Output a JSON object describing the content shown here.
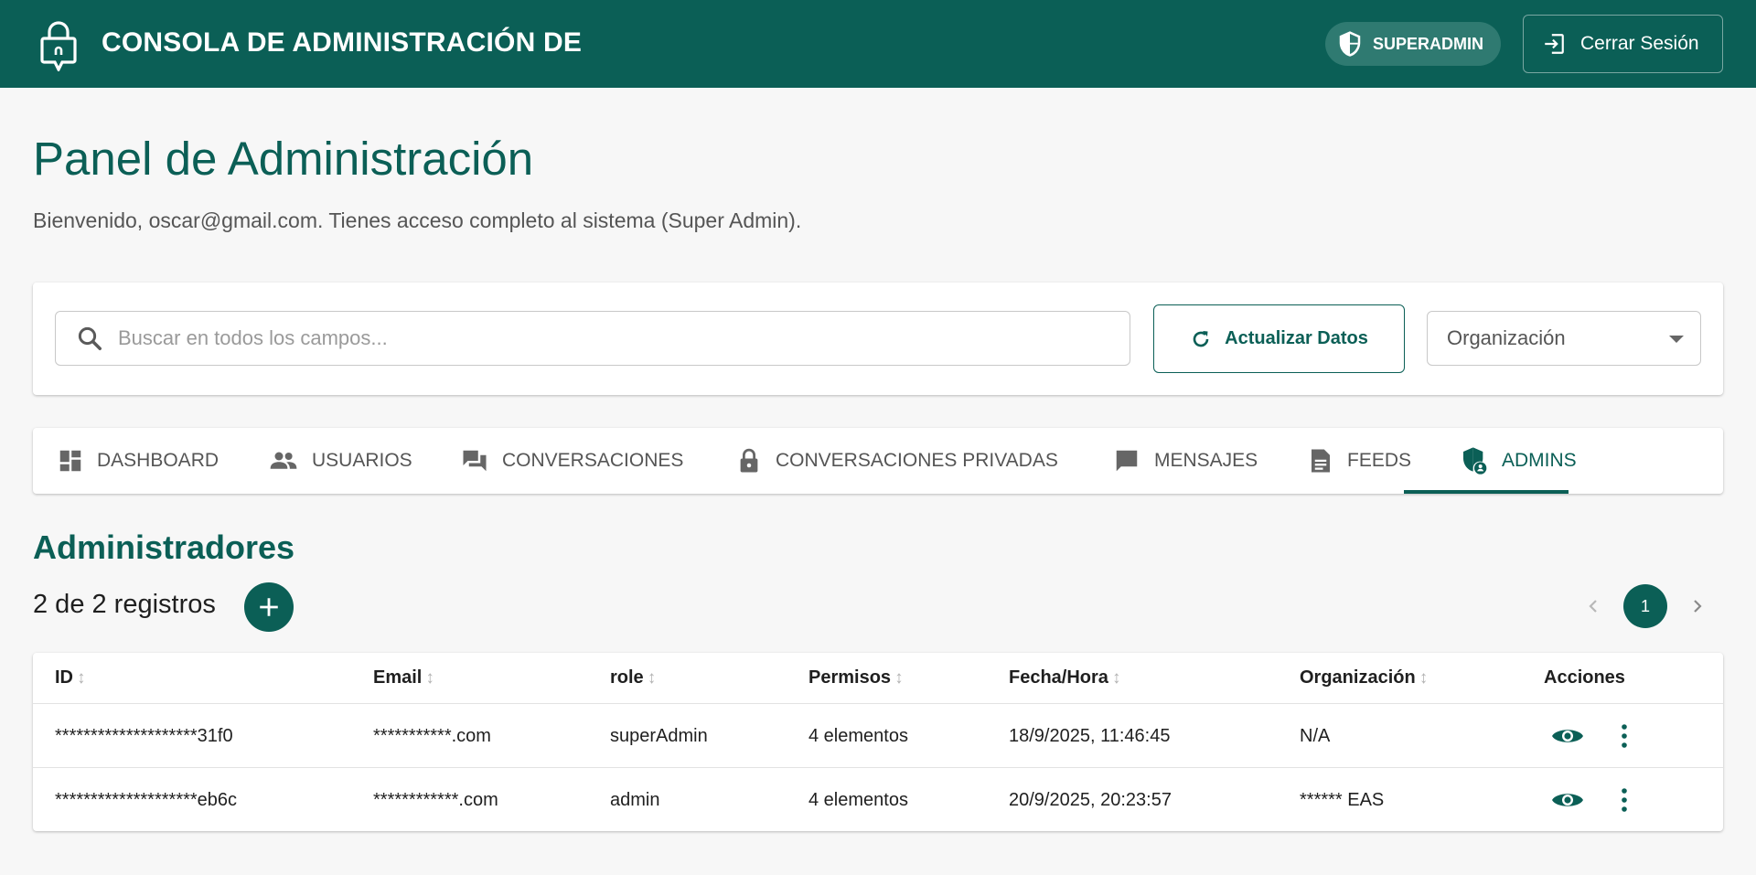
{
  "header": {
    "app_title": "CONSOLA DE ADMINISTRACIÓN DE",
    "role_badge": "SUPERADMIN",
    "logout_label": "Cerrar Sesión"
  },
  "page": {
    "title": "Panel de Administración",
    "welcome": "Bienvenido, oscar@gmail.com. Tienes acceso completo al sistema (Super Admin)."
  },
  "filters": {
    "search_placeholder": "Buscar en todos los campos...",
    "search_value": "",
    "refresh_label": "Actualizar Datos",
    "organization_label": "Organización"
  },
  "tabs": [
    {
      "label": "DASHBOARD",
      "icon": "dashboard-icon"
    },
    {
      "label": "USUARIOS",
      "icon": "people-icon"
    },
    {
      "label": "CONVERSACIONES",
      "icon": "forum-icon"
    },
    {
      "label": "CONVERSACIONES PRIVADAS",
      "icon": "lock-icon"
    },
    {
      "label": "MENSAJES",
      "icon": "chat-icon"
    },
    {
      "label": "FEEDS",
      "icon": "article-icon"
    },
    {
      "label": "ADMINS",
      "icon": "admin-shield-icon",
      "active": true
    }
  ],
  "section": {
    "title": "Administradores",
    "record_count": "2 de 2 registros"
  },
  "pagination": {
    "current_page": "1"
  },
  "table": {
    "columns": [
      "ID",
      "Email",
      "role",
      "Permisos",
      "Fecha/Hora",
      "Organización",
      "Acciones"
    ],
    "rows": [
      {
        "id": "********************31f0",
        "email": "***********.com",
        "role": "superAdmin",
        "permisos": "4 elementos",
        "fecha": "18/9/2025, 11:46:45",
        "organizacion": "N/A"
      },
      {
        "id": "********************eb6c",
        "email": "************.com",
        "role": "admin",
        "permisos": "4 elementos",
        "fecha": "20/9/2025, 20:23:57",
        "organizacion": "****** EAS"
      }
    ]
  },
  "colors": {
    "brand": "#0b5f56",
    "background": "#f7f7f7"
  }
}
